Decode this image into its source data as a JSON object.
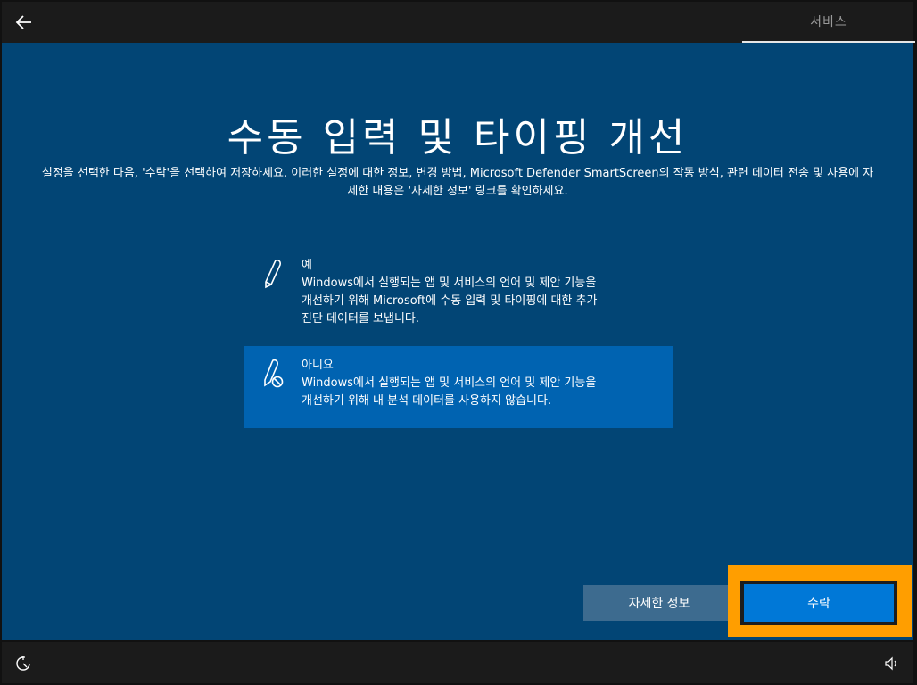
{
  "header": {
    "tab_label": "서비스"
  },
  "main": {
    "title": "수동 입력 및 타이핑 개선",
    "description": "설정을 선택한 다음, '수락'을 선택하여 저장하세요. 이러한 설정에 대한 정보, 변경 방법, Microsoft Defender SmartScreen의 작동 방식, 관련 데이터 전송 및 사용에 자세한 내용은 '자세한 정보' 링크를 확인하세요.",
    "options": [
      {
        "title": "예",
        "description": "Windows에서 실행되는 앱 및 서비스의 언어 및 제안 기능을\n개선하기 위해 Microsoft에 수동 입력 및 타이핑에 대한 추가\n진단 데이터를 보냅니다.",
        "icon": "pen-icon",
        "selected": false
      },
      {
        "title": "아니요",
        "description": "Windows에서 실행되는 앱 및 서비스의 언어 및 제안 기능을\n개선하기 위해 내 분석 데이터를 사용하지 않습니다.",
        "icon": "pen-blocked-icon",
        "selected": true
      }
    ]
  },
  "buttons": {
    "more_info": "자세한 정보",
    "accept": "수락"
  },
  "colors": {
    "background": "#024575",
    "selected_option": "#0063b1",
    "accept_button": "#0078d7",
    "highlight": "#ff9e00"
  }
}
